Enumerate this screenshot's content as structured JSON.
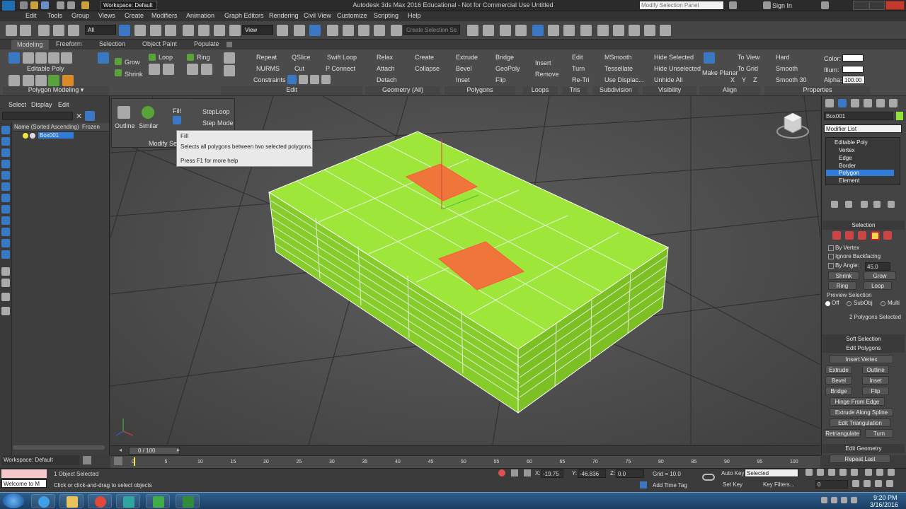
{
  "window": {
    "title": "Autodesk 3ds Max 2016 Educational - Not for Commercial Use   Untitled",
    "workspace_label": "Workspace: Default",
    "search_placeholder": "Modify Selection Panel",
    "sign_in": "Sign In"
  },
  "menubar": [
    "Edit",
    "Tools",
    "Group",
    "Views",
    "Create",
    "Modifiers",
    "Animation",
    "Graph Editors",
    "Rendering",
    "Civil View",
    "Customize",
    "Scripting",
    "Help"
  ],
  "main_toolbar": {
    "selection_filter": "All",
    "ref_coord": "View",
    "named_selection_placeholder": "Create Selection Se"
  },
  "ribbon": {
    "tabs": [
      "Modeling",
      "Freeform",
      "Selection",
      "Object Paint",
      "Populate"
    ],
    "active_tab": "Modeling",
    "object_type": "Editable Poly",
    "panel_polygon_modeling": "Polygon Modeling",
    "modify_selection": {
      "grow": "Grow",
      "shrink": "Shrink",
      "loop": "Loop",
      "ring": "Ring"
    },
    "edit": {
      "repeat": "Repeat",
      "qslice": "QSlice",
      "swift_loop": "Swift Loop",
      "nurms": "NURMS",
      "cut": "Cut",
      "p_connect": "P Connect",
      "constraints": "Constraints",
      "label": "Edit"
    },
    "geometry": {
      "relax": "Relax",
      "create": "Create",
      "attach": "Attach",
      "collapse": "Collapse",
      "detach": "Detach",
      "label": "Geometry (All)"
    },
    "polygons": {
      "extrude": "Extrude",
      "bridge": "Bridge",
      "bevel": "Bevel",
      "geopoly": "GeoPoly",
      "inset": "Inset",
      "flip": "Flip",
      "label": "Polygons"
    },
    "loops": {
      "insert": "Insert",
      "remove": "Remove",
      "label": "Loops"
    },
    "tris": {
      "edit": "Edit",
      "turn": "Turn",
      "retri": "Re-Tri",
      "label": "Tris"
    },
    "subdivision": {
      "msmooth": "MSmooth",
      "tessellate": "Tessellate",
      "use_displac": "Use Displac...",
      "label": "Subdivision"
    },
    "visibility": {
      "hide_selected": "Hide Selected",
      "hide_unselected": "Hide Unselected",
      "unhide_all": "Unhide All",
      "label": "Visibility"
    },
    "align": {
      "make_planar": "Make Planar",
      "to_view": "To View",
      "to_grid": "To Grid",
      "x": "X",
      "y": "Y",
      "z": "Z",
      "label": "Align"
    },
    "smoothing": {
      "hard": "Hard",
      "smooth": "Smooth",
      "smooth30": "Smooth 30"
    },
    "properties": {
      "color": "Color:",
      "illum": "Illum:",
      "alpha": "Alpha:",
      "alpha_value": "100.00",
      "label": "Properties"
    }
  },
  "flyout": {
    "outline": "Outline",
    "similar": "Similar",
    "fill": "Fill",
    "steploop": "StepLoop",
    "step_mode": "Step Mode",
    "modify_sel": "Modify Sele"
  },
  "tooltip": {
    "title": "Fill",
    "description": "Selects all polygons between two selected polygons.",
    "help": "Press F1 for more help"
  },
  "scene_explorer": {
    "menu": [
      "Select",
      "Display",
      "Edit"
    ],
    "columns": [
      "Name (Sorted Ascending)",
      "Frozen"
    ],
    "rows": [
      "Box001"
    ]
  },
  "command_panel": {
    "object_name": "Box001",
    "modifier_list": "Modifier List",
    "stack": [
      "Editable Poly",
      "Vertex",
      "Edge",
      "Border",
      "Polygon",
      "Element"
    ],
    "active_stack": "Polygon",
    "selection": {
      "header": "Selection",
      "by_vertex": "By Vertex",
      "ignore_backfacing": "Ignore Backfacing",
      "by_angle": "By Angle:",
      "angle_value": "45.0",
      "shrink": "Shrink",
      "grow": "Grow",
      "ring": "Ring",
      "loop": "Loop",
      "preview_selection": "Preview Selection",
      "off": "Off",
      "subobj": "SubObj",
      "multi": "Multi",
      "status": "2 Polygons Selected"
    },
    "soft_selection": "Soft Selection",
    "edit_polygons": {
      "header": "Edit Polygons",
      "insert_vertex": "Insert Vertex",
      "extrude": "Extrude",
      "outline": "Outline",
      "bevel": "Bevel",
      "inset": "Inset",
      "bridge": "Bridge",
      "flip": "Flip",
      "hinge": "Hinge From Edge",
      "extrude_spline": "Extrude Along Spline",
      "edit_tri": "Edit Triangulation",
      "retriangulate": "Retriangulate",
      "turn": "Turn"
    },
    "edit_geometry": "Edit Geometry",
    "repeat_last": "Repeat Last"
  },
  "timeline": {
    "frame": "0 / 100",
    "ticks": [
      "0",
      "5",
      "10",
      "15",
      "20",
      "25",
      "30",
      "35",
      "40",
      "45",
      "50",
      "55",
      "60",
      "65",
      "70",
      "75",
      "80",
      "85",
      "90",
      "95",
      "100"
    ]
  },
  "status": {
    "workspace": "Workspace: Default",
    "maxscript": "Welcome to M",
    "objects_selected": "1 Object Selected",
    "prompt": "Click or click-and-drag to select objects",
    "x_label": "X:",
    "x_value": "-19.75",
    "y_label": "Y:",
    "y_value": "-46.836",
    "z_label": "Z:",
    "z_value": "0.0",
    "grid": "Grid = 10.0",
    "add_time_tag": "Add Time Tag",
    "auto_key": "Auto Key",
    "selected": "Selected",
    "set_key": "Set Key",
    "key_filters": "Key Filters...",
    "frame_value": "0"
  },
  "taskbar": {
    "time": "9:20 PM",
    "date": "3/16/2016"
  },
  "colors": {
    "mesh": "#9ee63a",
    "selected_poly": "#f0753a",
    "highlight": "#2f7bd6"
  }
}
